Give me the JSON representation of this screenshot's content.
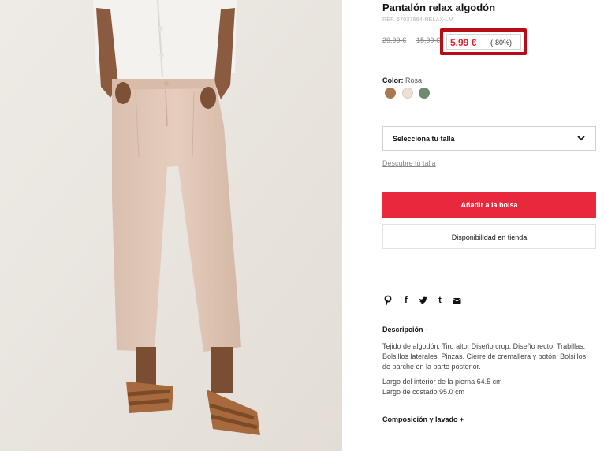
{
  "product": {
    "title": "Pantalón relax algodón",
    "ref": "REF. 67037664-RELAX-LM",
    "original_price": "29,99 €",
    "previous_price": "15,99 €",
    "sale_price": "5,99 €",
    "discount": "(-80%)"
  },
  "color": {
    "label": "Color:",
    "selected": "Rosa",
    "swatches": [
      {
        "icon": "swatch-camel",
        "hex": "#a8794e"
      },
      {
        "icon": "swatch-rosa",
        "hex": "#ece1d6"
      },
      {
        "icon": "swatch-khaki",
        "hex": "#6f8a6e"
      }
    ]
  },
  "size": {
    "select_label": "Selecciona tu talla",
    "guide_link": "Descubre tu talla"
  },
  "actions": {
    "add_to_bag": "Añadir a la bolsa",
    "store_availability": "Disponibilidad en tienda"
  },
  "share": {
    "icons": [
      "pinterest-icon",
      "facebook-icon",
      "twitter-icon",
      "tumblr-icon",
      "email-icon"
    ],
    "facebook_glyph": "f",
    "tumblr_glyph": "t"
  },
  "description": {
    "heading": "Descripción -",
    "text": "Tejido de algodón. Tiro alto. Diseño crop. Diseño recto. Trabillas. Bolsillos laterales. Pinzas. Cierre de cremallera y botón. Bolsillos de parche en la parte posterior.",
    "inseam": "Largo del interior de la pierna 64.5 cm",
    "side_length": "Largo de costado 95.0 cm"
  },
  "composition": {
    "heading": "Composición y lavado +"
  },
  "colors": {
    "accent_red": "#e8283b",
    "highlight_border": "#b80b16",
    "sale_text": "#e0202e"
  }
}
